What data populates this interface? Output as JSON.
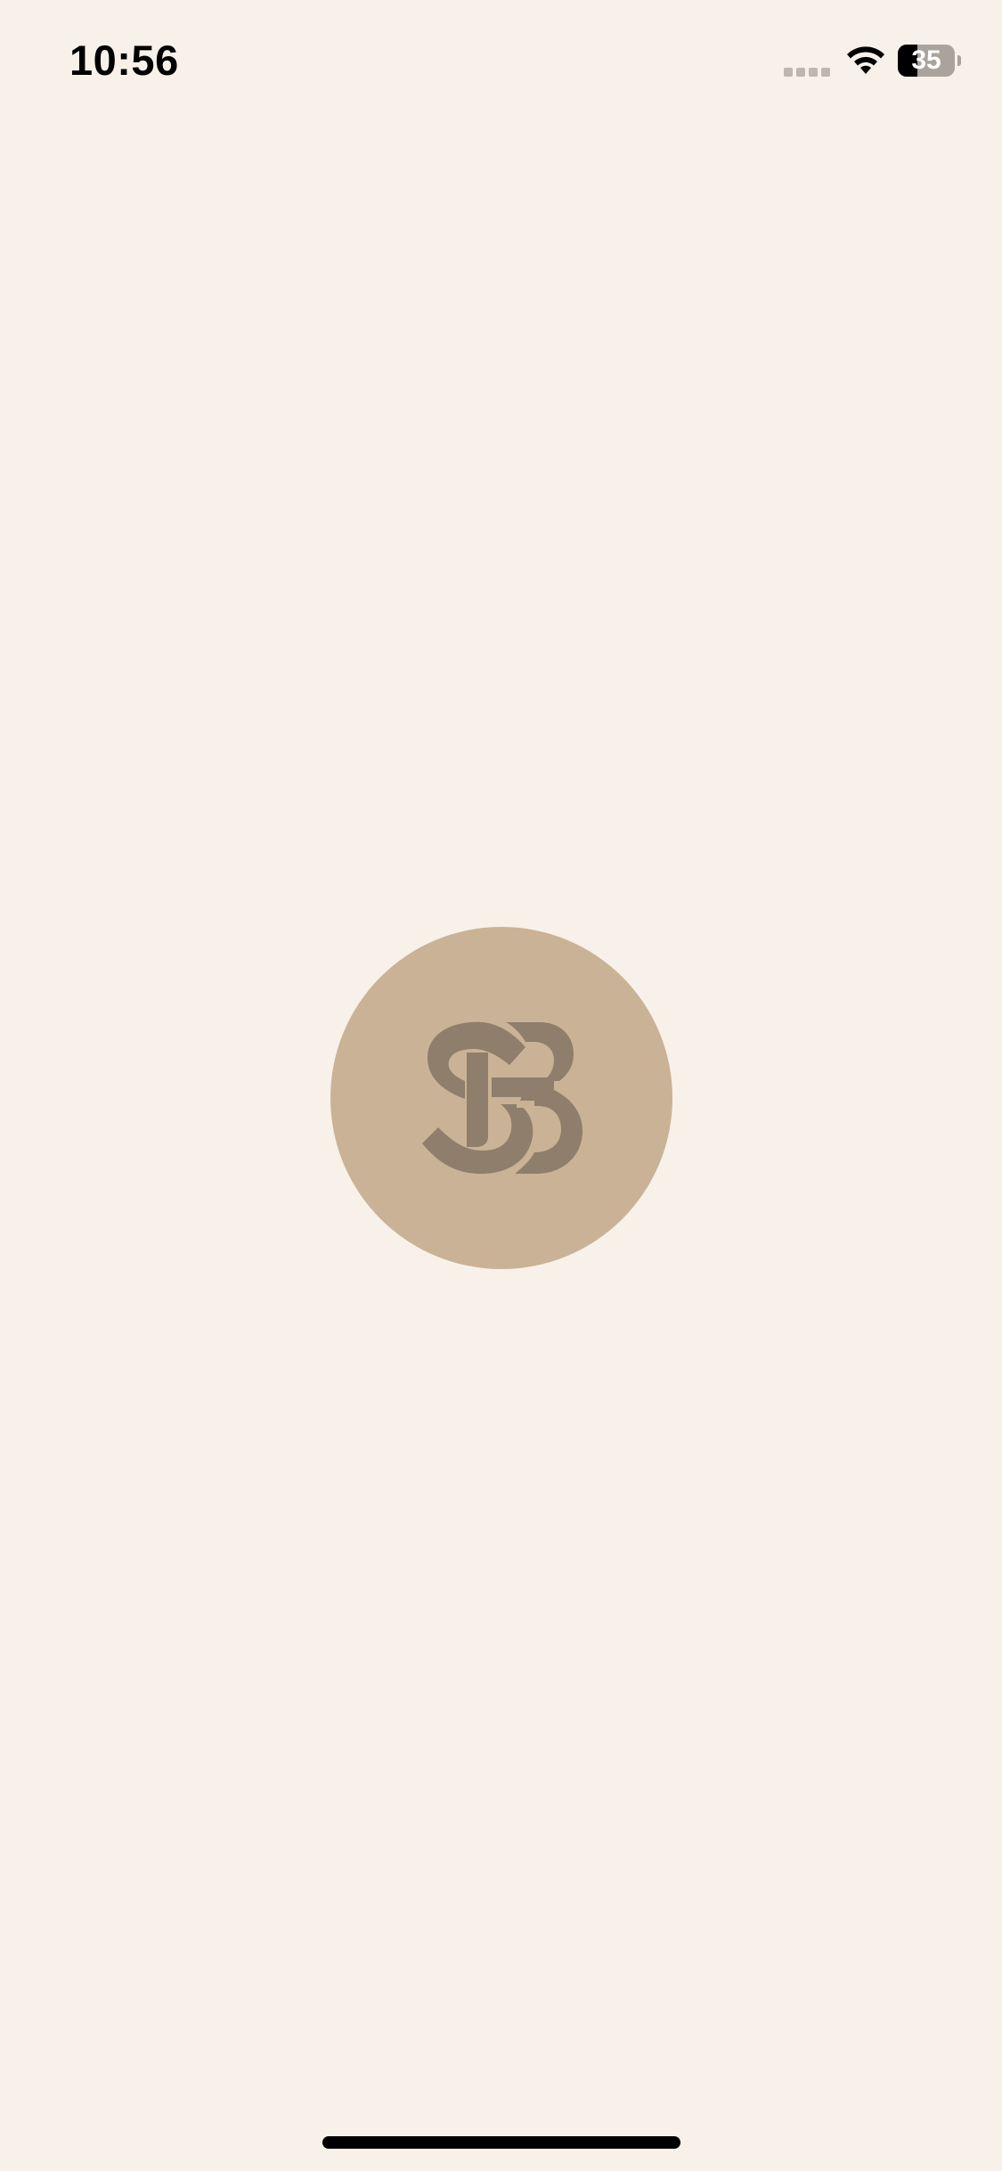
{
  "status_bar": {
    "time": "10:56",
    "battery_level": 0.35,
    "battery_label": "35",
    "signal_icon": "cellular-signal-icon",
    "wifi_icon": "wifi-icon",
    "battery_icon": "battery-icon"
  },
  "splash": {
    "logo_icon": "sb-monogram-logo",
    "logo_background_color": "#CAB296",
    "logo_mark_color": "#8E7E6B"
  },
  "colors": {
    "background": "#F7F1EA",
    "home_indicator": "#000000"
  }
}
